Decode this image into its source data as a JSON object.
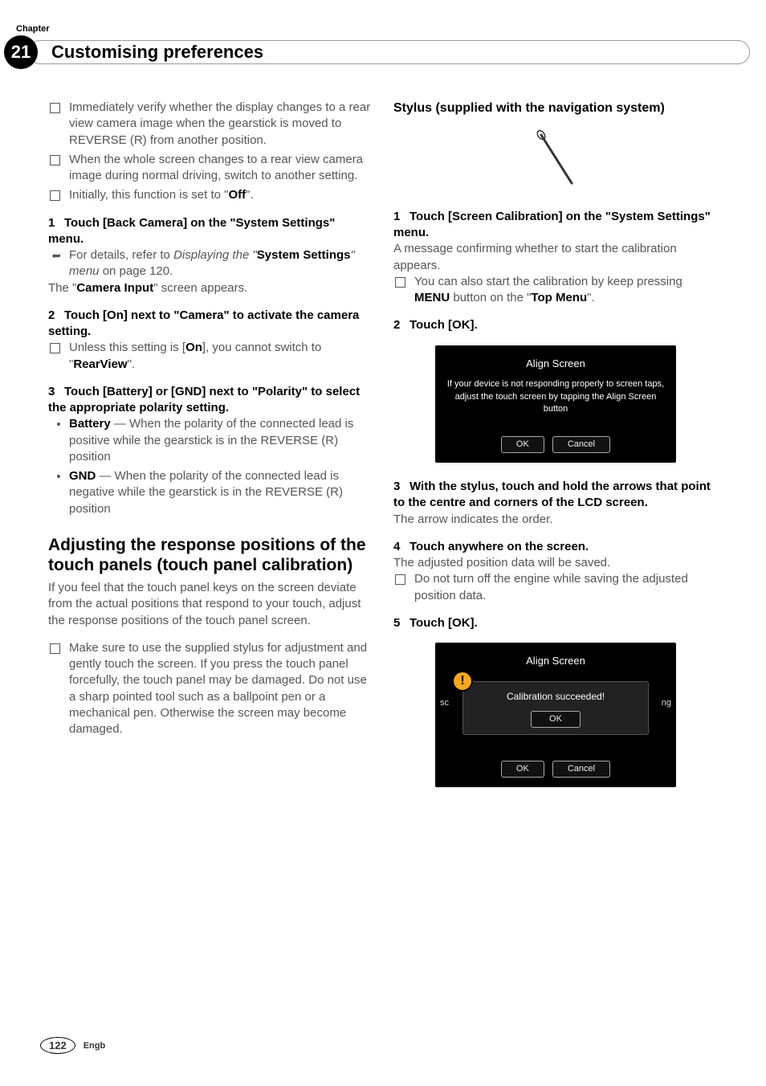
{
  "chapter_label": "Chapter",
  "chapter_number": "21",
  "title": "Customising preferences",
  "left": {
    "li1": "Immediately verify whether the display changes to a rear view camera image when the gearstick is moved to REVERSE (R) from another position.",
    "li2": "When the whole screen changes to a rear view camera image during normal driving, switch to another setting.",
    "li3_a": "Initially, this function is set to \"",
    "li3_b": "Off",
    "li3_c": "\".",
    "s1_num": "1",
    "s1_text": "Touch [Back Camera] on the \"System Settings\" menu.",
    "s1_xref_a": "For details, refer to ",
    "s1_xref_b": "Displaying the \"",
    "s1_xref_c": "System Settings",
    "s1_xref_d": "\" menu",
    "s1_xref_e": " on page 120.",
    "s1_after_a": "The \"",
    "s1_after_b": "Camera Input",
    "s1_after_c": "\" screen appears.",
    "s2_num": "2",
    "s2_text": "Touch [On] next to \"Camera\" to activate the camera setting.",
    "s2_li_a": "Unless this setting is [",
    "s2_li_b": "On",
    "s2_li_c": "], you cannot switch to \"",
    "s2_li_d": "RearView",
    "s2_li_e": "\".",
    "s3_num": "3",
    "s3_text": "Touch [Battery] or [GND] next to \"Polarity\" to select the appropriate polarity setting.",
    "s3_b1_a": "Battery",
    "s3_b1_b": " — When the polarity of the connected lead is positive while the gearstick is in the REVERSE (R) position",
    "s3_b2_a": "GND",
    "s3_b2_b": " — When the polarity of the connected lead is negative while the gearstick is in the REVERSE (R) position",
    "h2": "Adjusting the response positions of the touch panels (touch panel calibration)",
    "h2_body": "If you feel that the touch panel keys on the screen deviate from the actual positions that respond to your touch, adjust the response positions of the touch panel screen.",
    "h2_li": "Make sure to use the supplied stylus for adjustment and gently touch the screen. If you press the touch panel forcefully, the touch panel may be damaged. Do not use a sharp pointed tool such as a ballpoint pen or a mechanical pen. Otherwise the screen may become damaged."
  },
  "right": {
    "sub": "Stylus (supplied with the navigation system)",
    "s1_num": "1",
    "s1_text": "Touch [Screen Calibration] on the \"System Settings\" menu.",
    "s1_body": "A message confirming whether to start the calibration appears.",
    "s1_li_a": "You can also start the calibration by keep pressing ",
    "s1_li_b": "MENU",
    "s1_li_c": " button on the \"",
    "s1_li_d": "Top Menu",
    "s1_li_e": "\".",
    "s2_num": "2",
    "s2_text": "Touch [OK].",
    "ss1_title": "Align Screen",
    "ss1_body": "If your device is not responding properly to screen taps, adjust the touch screen by tapping the Align Screen button",
    "ss1_ok": "OK",
    "ss1_cancel": "Cancel",
    "s3_num": "3",
    "s3_text": "With the stylus, touch and hold the arrows that point to the centre and corners of the LCD screen.",
    "s3_body": "The arrow indicates the order.",
    "s4_num": "4",
    "s4_text": "Touch anywhere on the screen.",
    "s4_body": "The adjusted position data will be saved.",
    "s4_li": "Do not turn off the engine while saving the adjusted position data.",
    "s5_num": "5",
    "s5_text": "Touch [OK].",
    "ss2_title": "Align Screen",
    "ss2_left": "sc",
    "ss2_right": "ng",
    "ss2_popup_text": "Calibration succeeded!",
    "ss2_popup_ok": "OK",
    "ss2_ok": "OK",
    "ss2_cancel": "Cancel"
  },
  "footer": {
    "page": "122",
    "lang": "Engb"
  }
}
